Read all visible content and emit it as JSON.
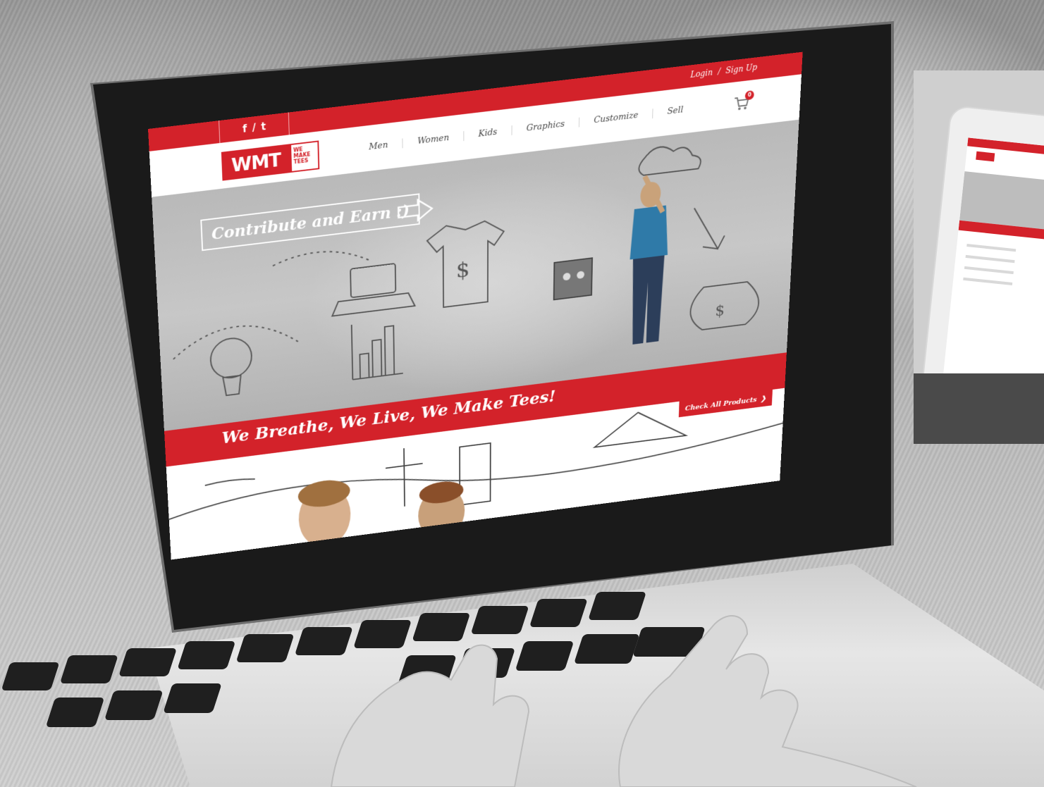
{
  "site": {
    "topbar": {
      "social": [
        "f",
        "/",
        "t"
      ],
      "auth": {
        "login": "Login",
        "separator": "/",
        "signup": "Sign Up"
      }
    },
    "logo": {
      "mark": "WMT",
      "tagline": "WE MAKE TEES"
    },
    "nav": [
      "Men",
      "Women",
      "Kids",
      "Graphics",
      "Customize",
      "Sell"
    ],
    "cart": {
      "count": "0"
    },
    "hero": {
      "headline": "Contribute and Earn :)"
    },
    "banner": {
      "tagline": "We Breathe, We Live, We Make Tees!"
    },
    "cta": {
      "label": "Check All Products",
      "chevron": "❯"
    }
  },
  "colors": {
    "brand_red": "#d3222a",
    "white": "#ffffff"
  },
  "icons": [
    "cart-icon",
    "arrow-right-icon",
    "facebook-icon",
    "twitter-icon",
    "chevron-right-icon"
  ]
}
